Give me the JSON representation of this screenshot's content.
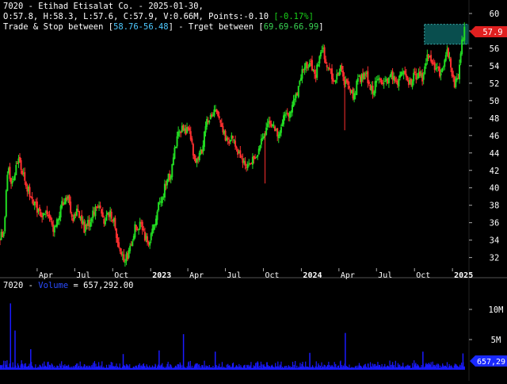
{
  "header": {
    "line1": "7020 - Etihad Etisalat Co. - 2025-01-30,",
    "ohlc_text": "O:57.8, H:58.3, L:57.6, C:57.9, V:0.66M, Points:-0.10 ",
    "change_pct": "[-0.17%]",
    "stop_prefix": "Trade & Stop between [",
    "stop_range": "58.76-56.48",
    "target_mid": "] - Trget between [",
    "target_range": "69.69-66.99",
    "target_suffix": "]"
  },
  "volume_header": {
    "symbol": "7020 -",
    "series_name": "Volume",
    "value_text": "= 657,292.00"
  },
  "last_price_tag": "57.9",
  "last_volume_tag": "657,29",
  "colors": {
    "background": "#000000",
    "bull_candle": "#22dd22",
    "bear_candle": "#ff3030",
    "volume_bar": "#1a1aff",
    "target_box": "#0b5c5c",
    "price_tag": "#e02020",
    "grid_separator": "#555555"
  },
  "chart_data": [
    {
      "type": "candlestick",
      "title": "7020 - Etihad Etisalat Co.",
      "x_tick_labels": [
        "Apr",
        "Jul",
        "Oct",
        "2023",
        "Apr",
        "Jul",
        "Oct",
        "2024",
        "Apr",
        "Jul",
        "Oct",
        "2025"
      ],
      "x_tick_dates": [
        "2022-04-01",
        "2022-07-01",
        "2022-10-01",
        "2023-01-01",
        "2023-04-01",
        "2023-07-01",
        "2023-10-01",
        "2024-01-01",
        "2024-04-01",
        "2024-07-01",
        "2024-10-01",
        "2025-01-01"
      ],
      "x_range": [
        "2022-01-01",
        "2025-02-10"
      ],
      "y_ticks": [
        32,
        34,
        36,
        38,
        40,
        42,
        44,
        46,
        48,
        50,
        52,
        54,
        56,
        58,
        60
      ],
      "ylim": [
        30.6,
        61
      ],
      "close_path": {
        "dates": [
          "2022-01-01",
          "2022-01-10",
          "2022-01-20",
          "2022-02-01",
          "2022-02-15",
          "2022-02-28",
          "2022-03-10",
          "2022-03-25",
          "2022-04-08",
          "2022-04-25",
          "2022-05-10",
          "2022-05-25",
          "2022-06-10",
          "2022-06-25",
          "2022-07-10",
          "2022-07-25",
          "2022-08-10",
          "2022-08-25",
          "2022-09-10",
          "2022-09-25",
          "2022-10-05",
          "2022-10-20",
          "2022-11-01",
          "2022-11-15",
          "2022-11-25",
          "2022-12-10",
          "2022-12-25",
          "2023-01-05",
          "2023-01-20",
          "2023-02-05",
          "2023-02-20",
          "2023-03-05",
          "2023-03-20",
          "2023-04-05",
          "2023-04-20",
          "2023-05-05",
          "2023-05-20",
          "2023-06-05",
          "2023-06-20",
          "2023-07-05",
          "2023-07-20",
          "2023-08-05",
          "2023-08-20",
          "2023-09-05",
          "2023-09-20",
          "2023-10-05",
          "2023-10-20",
          "2023-11-05",
          "2023-11-20",
          "2023-12-05",
          "2023-12-20",
          "2024-01-05",
          "2024-01-20",
          "2024-02-05",
          "2024-02-20",
          "2024-03-05",
          "2024-03-20",
          "2024-04-05",
          "2024-04-20",
          "2024-05-05",
          "2024-05-20",
          "2024-06-05",
          "2024-06-20",
          "2024-07-05",
          "2024-07-20",
          "2024-08-05",
          "2024-08-20",
          "2024-09-05",
          "2024-09-20",
          "2024-10-05",
          "2024-10-20",
          "2024-11-05",
          "2024-11-20",
          "2024-12-05",
          "2024-12-20",
          "2025-01-05",
          "2025-01-15",
          "2025-01-25",
          "2025-01-30"
        ],
        "close": [
          34.2,
          35,
          42,
          40.5,
          43.5,
          41,
          39.8,
          38.2,
          36.8,
          37.5,
          35.5,
          37,
          39.5,
          36.5,
          37.2,
          35.2,
          36.5,
          38,
          36,
          37.5,
          35.8,
          32.2,
          31.6,
          33.8,
          35.5,
          35.8,
          33.2,
          35,
          38,
          40,
          42,
          45.5,
          47,
          46.2,
          43,
          44.5,
          48,
          49,
          47.5,
          45,
          46,
          43.5,
          42,
          43,
          44.5,
          46.5,
          47.5,
          46,
          48,
          49,
          50.5,
          53.5,
          54.5,
          53,
          56,
          54,
          52,
          53.5,
          51.5,
          50.5,
          52.5,
          53,
          51,
          52.5,
          52,
          53,
          51.8,
          53.5,
          52,
          53,
          52.5,
          55.5,
          54,
          53,
          55.5,
          52,
          53,
          57,
          57.9
        ]
      },
      "last_close": 57.9,
      "target_band": [
        56.48,
        58.76
      ],
      "target_band_dates": [
        "2024-10-25",
        "2025-02-10"
      ]
    },
    {
      "type": "bar",
      "series": [
        {
          "name": "Volume"
        }
      ],
      "y_ticks": [
        5000000,
        10000000
      ],
      "y_tick_labels": [
        "5M",
        "10M"
      ],
      "ylim": [
        0,
        15000000
      ],
      "last_value": 657292,
      "spikes": [
        {
          "date": "2022-01-25",
          "value": 11000000
        },
        {
          "date": "2022-02-05",
          "value": 6500000
        },
        {
          "date": "2022-03-15",
          "value": 3400000
        },
        {
          "date": "2022-10-25",
          "value": 2600000
        },
        {
          "date": "2023-01-20",
          "value": 3200000
        },
        {
          "date": "2023-03-20",
          "value": 5900000
        },
        {
          "date": "2023-06-05",
          "value": 3000000
        },
        {
          "date": "2024-01-20",
          "value": 2800000
        },
        {
          "date": "2024-04-15",
          "value": 6100000
        },
        {
          "date": "2024-10-20",
          "value": 3000000
        },
        {
          "date": "2025-01-25",
          "value": 2700000
        }
      ]
    }
  ]
}
